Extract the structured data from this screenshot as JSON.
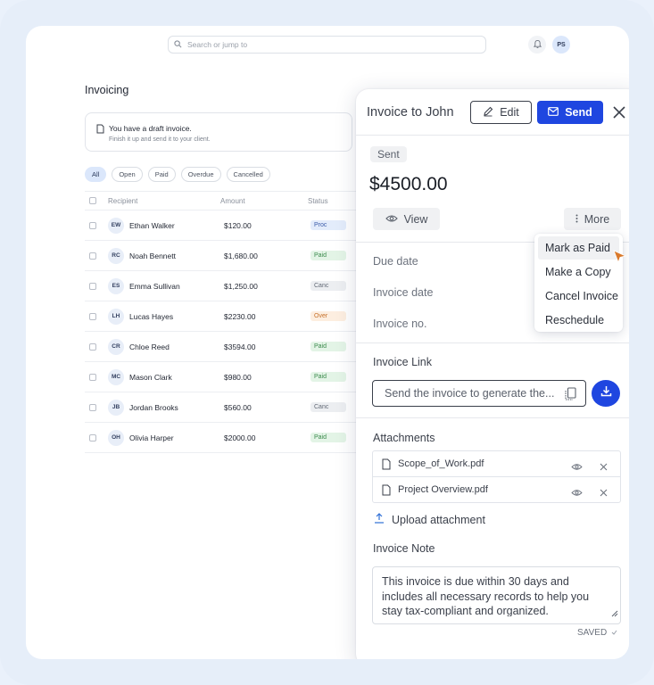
{
  "header": {
    "search_placeholder": "Search or jump to",
    "user_initials": "PS"
  },
  "page": {
    "title": "Invoicing",
    "draft_title": "You have a draft invoice.",
    "draft_subtitle": "Finish it up and send it to your client."
  },
  "filters": [
    "All",
    "Open",
    "Paid",
    "Overdue",
    "Cancelled"
  ],
  "table": {
    "headers": {
      "recipient": "Recipient",
      "amount": "Amount",
      "status": "Status"
    },
    "rows": [
      {
        "initials": "EW",
        "name": "Ethan Walker",
        "amount": "$120.00",
        "status": "Proc",
        "kind": "proc"
      },
      {
        "initials": "RC",
        "name": "Noah Bennett",
        "amount": "$1,680.00",
        "status": "Paid",
        "kind": "paid"
      },
      {
        "initials": "ES",
        "name": "Emma Sullivan",
        "amount": "$1,250.00",
        "status": "Canc",
        "kind": "canc"
      },
      {
        "initials": "LH",
        "name": "Lucas Hayes",
        "amount": "$2230.00",
        "status": "Over",
        "kind": "over"
      },
      {
        "initials": "CR",
        "name": "Chloe Reed",
        "amount": "$3594.00",
        "status": "Paid",
        "kind": "paid"
      },
      {
        "initials": "MC",
        "name": "Mason Clark",
        "amount": "$980.00",
        "status": "Paid",
        "kind": "paid"
      },
      {
        "initials": "JB",
        "name": "Jordan Brooks",
        "amount": "$560.00",
        "status": "Canc",
        "kind": "canc"
      },
      {
        "initials": "OH",
        "name": "Olivia Harper",
        "amount": "$2000.00",
        "status": "Paid",
        "kind": "paid"
      }
    ]
  },
  "panel": {
    "title": "Invoice to John",
    "edit_label": "Edit",
    "send_label": "Send",
    "status": "Sent",
    "amount": "$4500.00",
    "view_label": "View",
    "more_label": "More",
    "menu": [
      "Mark as Paid",
      "Make a Copy",
      "Cancel Invoice",
      "Reschedule"
    ],
    "fields": {
      "due": "Due date",
      "invoice_date": "Invoice date",
      "invoice_no": "Invoice no."
    },
    "link_label": "Invoice Link",
    "link_placeholder": "Send the invoice to generate the...",
    "attachments_label": "Attachments",
    "attachments": [
      "Scope_of_Work.pdf",
      "Project Overview.pdf"
    ],
    "upload_label": "Upload attachment",
    "note_label": "Invoice Note",
    "note_text": "This invoice is due within 30 days and includes all necessary records to help you stay tax-compliant and organized.",
    "saved_label": "SAVED"
  },
  "colors": {
    "accent": "#1f46e0",
    "cursor": "#d9792b"
  }
}
